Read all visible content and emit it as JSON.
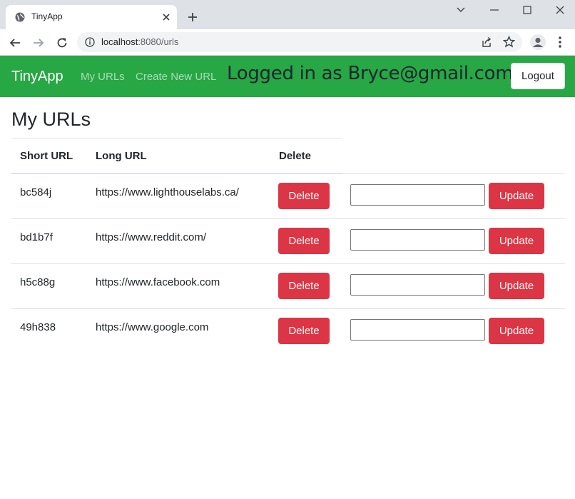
{
  "browser": {
    "tab_title": "TinyApp",
    "url_host": "localhost",
    "url_path": ":8080/urls"
  },
  "navbar": {
    "brand": "TinyApp",
    "links": [
      "My URLs",
      "Create New URL"
    ],
    "logged_in_text": "Logged in as Bryce@gmail.com",
    "logout_label": "Logout",
    "bg_color": "#28a745"
  },
  "main": {
    "title": "My URLs",
    "headers": {
      "short_url": "Short URL",
      "long_url": "Long URL",
      "delete": "Delete"
    },
    "rows": [
      {
        "short": "bc584j",
        "long": "https://www.lighthouselabs.ca/",
        "delete_label": "Delete",
        "update_label": "Update",
        "input_value": ""
      },
      {
        "short": "bd1b7f",
        "long": "https://www.reddit.com/",
        "delete_label": "Delete",
        "update_label": "Update",
        "input_value": ""
      },
      {
        "short": "h5c88g",
        "long": "https://www.facebook.com",
        "delete_label": "Delete",
        "update_label": "Update",
        "input_value": ""
      },
      {
        "short": "49h838",
        "long": "https://www.google.com",
        "delete_label": "Delete",
        "update_label": "Update",
        "input_value": ""
      }
    ],
    "button_color": "#dc3545"
  },
  "icons": [
    "globe-icon",
    "close-icon",
    "plus-icon",
    "minimize-icon",
    "maximize-icon",
    "window-close-icon",
    "back-arrow-icon",
    "forward-arrow-icon",
    "reload-icon",
    "info-icon",
    "share-icon",
    "star-icon",
    "profile-icon",
    "menu-dots-icon"
  ]
}
